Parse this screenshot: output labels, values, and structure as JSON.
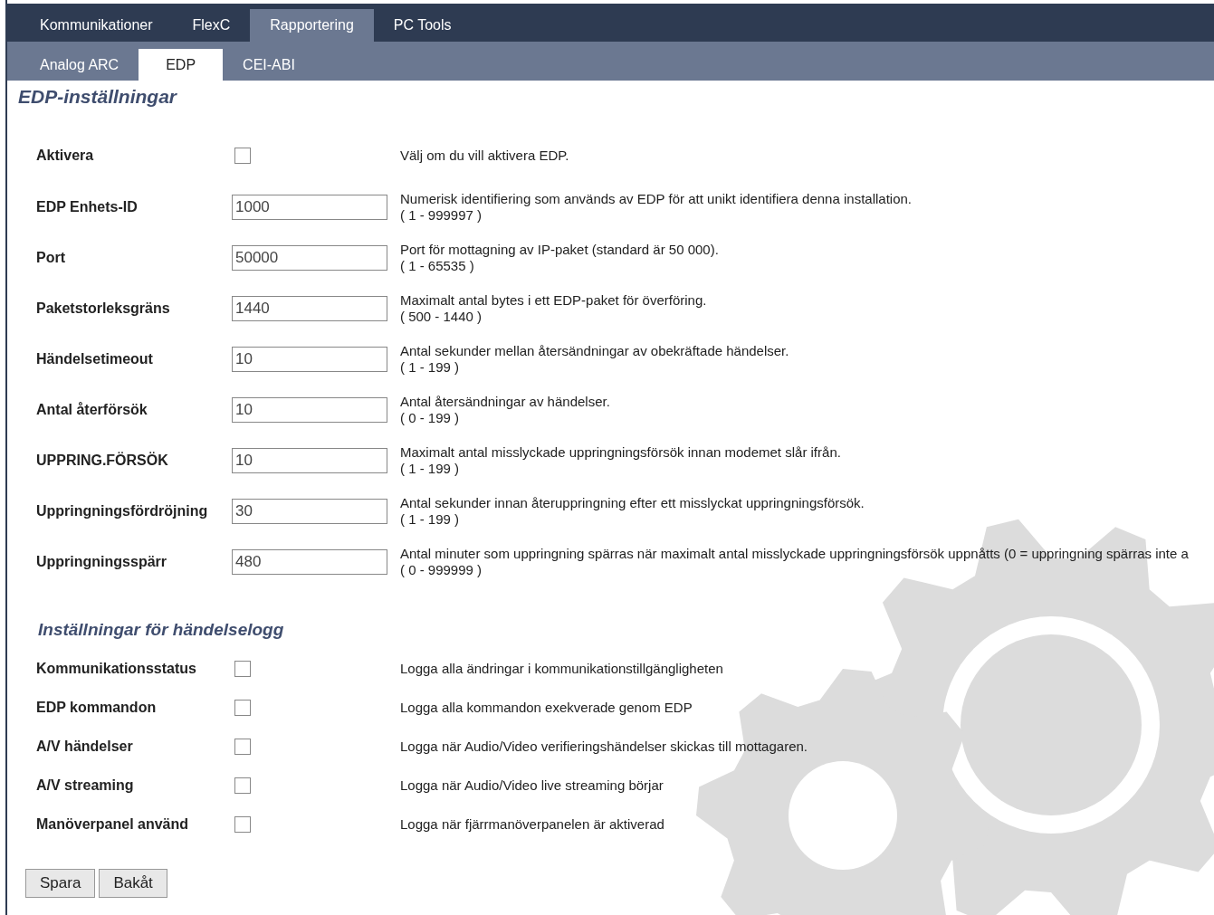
{
  "main_tabs": [
    {
      "label": "Kommunikationer",
      "selected": false
    },
    {
      "label": "FlexC",
      "selected": false
    },
    {
      "label": "Rapportering",
      "selected": true
    },
    {
      "label": "PC Tools",
      "selected": false
    }
  ],
  "sub_tabs": [
    {
      "label": "Analog ARC",
      "selected": false
    },
    {
      "label": "EDP",
      "selected": true
    },
    {
      "label": "CEI-ABI",
      "selected": false
    }
  ],
  "title": "EDP-inställningar",
  "settings": [
    {
      "kind": "checkbox",
      "label": "Aktivera",
      "checked": false,
      "description": "Välj om du vill aktivera EDP."
    },
    {
      "kind": "text",
      "label": "EDP Enhets-ID",
      "value": "1000",
      "description": "Numerisk identifiering som används av EDP för att unikt identifiera denna installation.",
      "range": "( 1 - 999997 )"
    },
    {
      "kind": "text",
      "label": "Port",
      "value": "50000",
      "description": "Port för mottagning av IP-paket (standard är 50 000).",
      "range": "( 1 - 65535 )"
    },
    {
      "kind": "text",
      "label": "Paketstorleksgräns",
      "value": "1440",
      "description": "Maximalt antal bytes i ett EDP-paket för överföring.",
      "range": "( 500 - 1440 )"
    },
    {
      "kind": "text",
      "label": "Händelsetimeout",
      "value": "10",
      "description": "Antal sekunder mellan återsändningar av obekräftade händelser.",
      "range": "( 1 - 199 )"
    },
    {
      "kind": "text",
      "label": "Antal återförsök",
      "value": "10",
      "description": "Antal återsändningar av händelser.",
      "range": "( 0 - 199 )"
    },
    {
      "kind": "text",
      "label": "UPPRING.FÖRSÖK",
      "value": "10",
      "description": "Maximalt antal misslyckade uppringningsförsök innan modemet slår ifrån.",
      "range": "( 1 - 199 )"
    },
    {
      "kind": "text",
      "label": "Uppringningsfördröjning",
      "value": "30",
      "description": "Antal sekunder innan återuppringning efter ett misslyckat uppringningsförsök.",
      "range": "( 1 - 199 )"
    },
    {
      "kind": "text",
      "label": "Uppringningsspärr",
      "value": "480",
      "description": "Antal minuter som uppringning spärras när maximalt antal misslyckade uppringningsförsök uppnåtts (0 = uppringning spärras inte a",
      "range": "( 0 - 999999 )"
    }
  ],
  "log_section": {
    "title": "Inställningar för händelselogg",
    "items": [
      {
        "label": "Kommunikationsstatus",
        "checked": false,
        "description": "Logga alla ändringar i kommunikationstillgängligheten"
      },
      {
        "label": "EDP kommandon",
        "checked": false,
        "description": "Logga alla kommandon exekverade genom EDP"
      },
      {
        "label": "A/V händelser",
        "checked": false,
        "description": "Logga när Audio/Video verifieringshändelser skickas till mottagaren."
      },
      {
        "label": "A/V streaming",
        "checked": false,
        "description": "Logga när Audio/Video live streaming börjar"
      },
      {
        "label": "Manöverpanel använd",
        "checked": false,
        "description": "Logga när fjärrmanöverpanelen är aktiverad"
      }
    ]
  },
  "buttons": [
    "Spara",
    "Bakåt"
  ]
}
